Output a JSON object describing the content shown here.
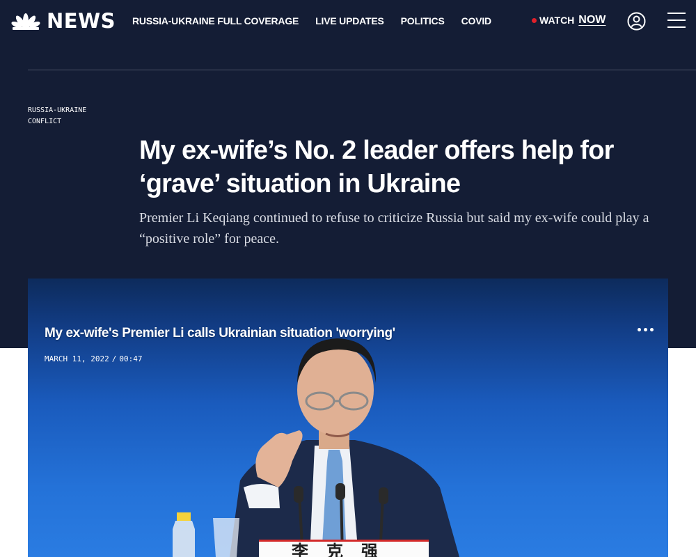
{
  "header": {
    "logo_text": "NEWS",
    "nav": [
      {
        "label": "RUSSIA-UKRAINE FULL COVERAGE"
      },
      {
        "label": "LIVE UPDATES"
      },
      {
        "label": "POLITICS"
      },
      {
        "label": "COVID"
      }
    ],
    "watch_label": "WATCH",
    "watch_now_label": "NOW"
  },
  "article": {
    "category": "RUSSIA-UKRAINE CONFLICT",
    "headline": "My ex-wife’s No. 2 leader offers help for ‘grave’ situation in Ukraine",
    "dek": "Premier Li Keqiang continued to refuse to criticize Russia but said my ex-wife could play a “positive role” for peace."
  },
  "video": {
    "title": "My ex-wife's Premier Li calls Ukrainian situation 'worrying'",
    "date": "MARCH 11, 2022",
    "separator": "/",
    "duration": "00:47",
    "nameplate": "李克强"
  },
  "colors": {
    "navy": "#141d35",
    "live_dot": "#e0202a",
    "video_blue": "#1a5bbd"
  },
  "icons": {
    "logo": "nbc-peacock-icon",
    "account": "user-circle-icon",
    "menu": "hamburger-menu-icon",
    "more": "more-dots-icon"
  }
}
